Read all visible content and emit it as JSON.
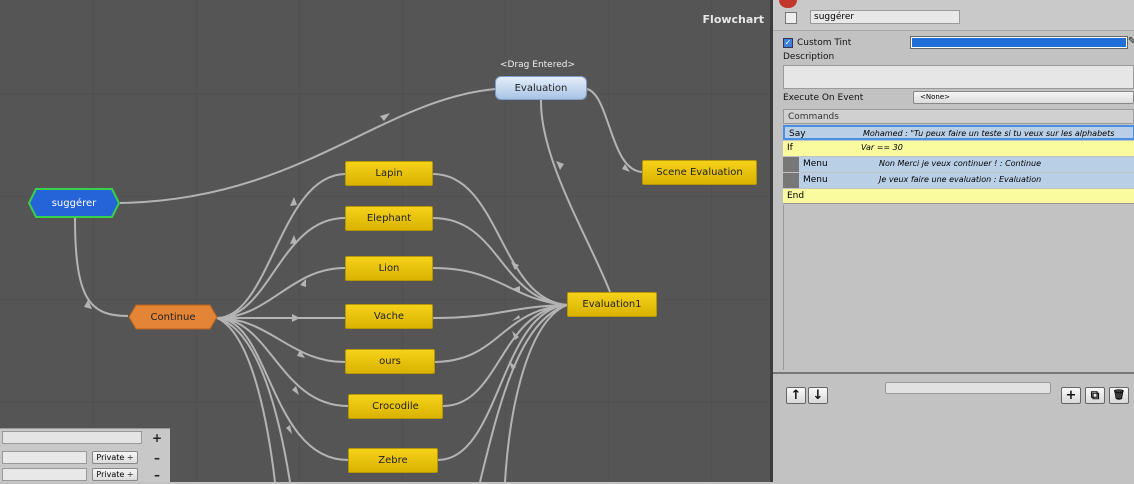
{
  "flowchart": {
    "title": "Flowchart",
    "drag_label": "<Drag Entered>",
    "blocks": {
      "evaluation": "Evaluation",
      "suggerer": "suggérer",
      "continue": "Continue",
      "scene_evaluation": "Scene Evaluation",
      "evaluation1": "Evaluation1",
      "lapin": "Lapin",
      "elephant": "Elephant",
      "lion": "Lion",
      "vache": "Vache",
      "ours": "ours",
      "crocodile": "Crocodile",
      "zebre": "Zebre"
    }
  },
  "variables_panel": {
    "add_label": "+",
    "rows": [
      {
        "scope": "Private ÷",
        "remove_label": "–"
      },
      {
        "scope": "Private ÷",
        "remove_label": "–"
      }
    ]
  },
  "inspector": {
    "block_name": "suggérer",
    "custom_tint_label": "Custom Tint",
    "custom_tint_color": "#1f6fd6",
    "description_label": "Description",
    "description_value": "",
    "execute_on_event_label": "Execute On Event",
    "execute_on_event_value": "<None>",
    "commands_label": "Commands",
    "commands": [
      {
        "name": "Say",
        "summary": "Mohamed : \"Tu peux faire un teste si tu veux sur les alphabets",
        "color": "#b9cfe6"
      },
      {
        "name": "If",
        "summary": "Var == 30",
        "color": "#fafa9e"
      },
      {
        "name": "Menu",
        "summary": "Non Merci je veux continuer ! : Continue",
        "color": "#b9cfe6"
      },
      {
        "name": "Menu",
        "summary": "Je veux faire une evaluation : Evaluation",
        "color": "#b9cfe6"
      },
      {
        "name": "End",
        "summary": "",
        "color": "#fafa9e"
      }
    ],
    "toolbar": {
      "up": "↑",
      "down": "↓",
      "add": "+",
      "duplicate": "⧉",
      "delete": "🗑"
    }
  }
}
